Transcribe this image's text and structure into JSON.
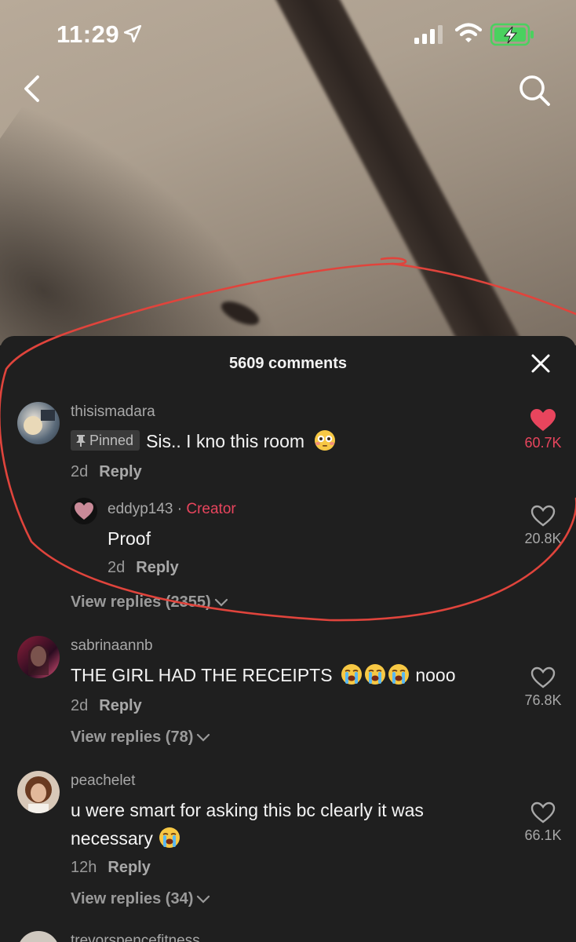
{
  "status_bar": {
    "time": "11:29"
  },
  "sheet": {
    "title": "5609 comments"
  },
  "comments": [
    {
      "username": "thisismadara",
      "pinned_label": "Pinned",
      "text": "Sis.. I kno this room",
      "age": "2d",
      "reply_label": "Reply",
      "likes": "60.7K",
      "liked": true,
      "replies": [
        {
          "username": "eddyp143",
          "creator_label": "Creator",
          "text": "Proof",
          "age": "2d",
          "reply_label": "Reply",
          "likes": "20.8K"
        }
      ],
      "view_replies": "View replies (2355)"
    },
    {
      "username": "sabrinaannb",
      "text_before": "THE GIRL HAD THE RECEIPTS",
      "text_after": "nooo",
      "age": "2d",
      "reply_label": "Reply",
      "likes": "76.8K",
      "view_replies": "View replies (78)"
    },
    {
      "username": "peachelet",
      "text_line1": "u were smart for asking this bc clearly it was",
      "text_line2": "necessary",
      "age": "12h",
      "reply_label": "Reply",
      "likes": "66.1K",
      "view_replies": "View replies (34)"
    },
    {
      "username": "trevorspencefitness"
    }
  ],
  "colors": {
    "accent_red": "#e8455d",
    "sheet_bg": "#1f1f1f",
    "annotation_red": "#e0443c"
  }
}
